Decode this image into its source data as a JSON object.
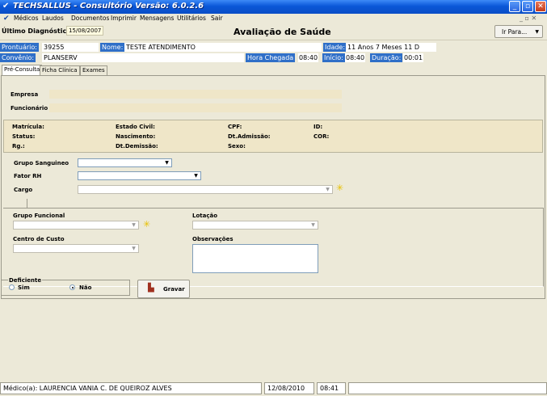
{
  "window": {
    "title": "TECHSALLUS - Consultório  Versão: 6.0.2.6",
    "app_icon": "stethoscope-icon"
  },
  "menu": [
    "Médicos",
    "Laudos",
    "Documentos",
    "Imprimir",
    "Mensagens",
    "Utilitários",
    "Sair"
  ],
  "toolbar": {
    "ultimo_label": "Último Diagnóstico",
    "ultimo_value": "15/08/2007",
    "screen_title": "Avaliação de Saúde",
    "ir_para": "Ir Para..."
  },
  "patient": {
    "prontuario_label": "Prontuário:",
    "prontuario": "39255",
    "nome_label": "Nome:",
    "nome": "TESTE ATENDIMENTO",
    "idade_label": "Idade:",
    "idade": "11 Anos 7 Meses 11 D",
    "convenio_label": "Convênio:",
    "convenio": "PLANSERV",
    "hora_label": "Hora Chegada",
    "hora": "08:40",
    "inicio_label": "Início:",
    "inicio": "08:40",
    "duracao_label": "Duração:",
    "duracao": "00:01"
  },
  "tabs": [
    "Pré-Consulta",
    "Ficha Clínica",
    "Exames"
  ],
  "empresa": {
    "empresa": "Empresa",
    "funcionario": "Funcionário"
  },
  "info": {
    "c1": [
      "Matrícula:",
      "Status:",
      "Rg.:"
    ],
    "c2": [
      "Estado Civil:",
      "Nascimento:",
      "Dt.Demissão:"
    ],
    "c3": [
      "CPF:",
      "Dt.Admissão:",
      "Sexo:"
    ],
    "c4": [
      "ID:",
      "COR:"
    ]
  },
  "form": {
    "grupo_sanguineo": "Grupo Sanguineo",
    "fator_rh": "Fator RH",
    "cargo": "Cargo",
    "grupo_funcional": "Grupo Funcional",
    "lotacao": "Lotação",
    "centro_custo": "Centro de Custo",
    "observacoes": "Observações"
  },
  "deficiente": {
    "label": "Deficiente",
    "sim": "Sim",
    "nao": "Não",
    "selected": "Não"
  },
  "gravar": "Gravar",
  "status": {
    "medico": "Médico(a): LAURENCIA VANIA C. DE QUEIROZ ALVES",
    "date": "12/08/2010",
    "time": "08:41"
  }
}
